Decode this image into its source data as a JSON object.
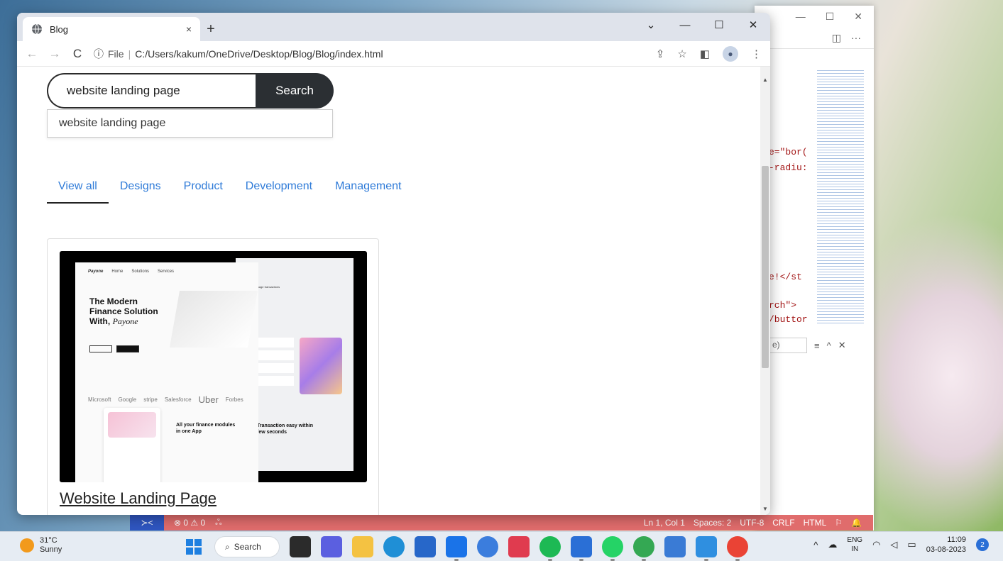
{
  "browser": {
    "tab_title": "Blog",
    "tab_close": "×",
    "new_tab": "+",
    "window_controls": {
      "collapse": "⌄",
      "minimize": "—",
      "maximize": "☐",
      "close": "✕"
    },
    "nav": {
      "back": "←",
      "forward": "→",
      "reload": "C"
    },
    "address": {
      "info_icon": "ⓘ",
      "scheme_label": "File",
      "separator": "|",
      "path": "C:/Users/kakum/OneDrive/Desktop/Blog/Blog/index.html"
    },
    "toolbar_icons": {
      "share": "⇪",
      "bookmark": "☆",
      "sidepanel": "◧",
      "profile": "●",
      "menu": "⋮"
    }
  },
  "page": {
    "search": {
      "value": "website landing page",
      "button_label": "Search",
      "suggestion": "website landing page"
    },
    "filters": [
      {
        "label": "View all",
        "active": true
      },
      {
        "label": "Designs",
        "active": false
      },
      {
        "label": "Product",
        "active": false
      },
      {
        "label": "Development",
        "active": false
      },
      {
        "label": "Management",
        "active": false
      }
    ],
    "card": {
      "title": "Website Landing Page",
      "thumbnail": {
        "logo": "Payone",
        "nav": [
          "Home",
          "Solutions",
          "Services"
        ],
        "hero_line1": "The Modern",
        "hero_line2": "Finance Solution",
        "hero_line3": "With,",
        "hero_brand": "Payone",
        "logos": [
          "Microsoft",
          "Google",
          "stripe",
          "Salesforce",
          "Uber",
          "Forbes"
        ],
        "modules_heading": "All your finance modules in one App",
        "transaction_heading": "Transaction easy within few seconds",
        "side_label": "Manage transactions"
      }
    }
  },
  "vscode": {
    "window_controls": {
      "minimize": "—",
      "maximize": "☐",
      "close": "✕"
    },
    "toolbar": {
      "split": "◫",
      "more": "···"
    },
    "code_fragments": [
      "e=\"bor(",
      "-radiu:",
      "e!</st",
      "rch\">",
      "/buttor"
    ],
    "find_placeholder": "e)",
    "find_icons": {
      "list": "≡",
      "up": "^",
      "close": "✕"
    },
    "status": {
      "remote": "≻<",
      "problems": "⊗ 0 ⚠ 0",
      "live": "ஃ",
      "position": "Ln 1, Col 1",
      "spaces": "Spaces: 2",
      "encoding": "UTF-8",
      "eol": "CRLF",
      "language": "HTML",
      "feedback": "⚐",
      "bell": "🔔"
    }
  },
  "taskbar": {
    "weather_temp": "31°C",
    "weather_desc": "Sunny",
    "search_label": "Search",
    "lang_line1": "ENG",
    "lang_line2": "IN",
    "time": "11:09",
    "date": "03-08-2023",
    "notifications": "2",
    "tray_chevron": "^"
  },
  "colors": {
    "link_blue": "#2f7bd8",
    "search_button": "#2b2f33",
    "vscode_status": "#e06c6c"
  }
}
